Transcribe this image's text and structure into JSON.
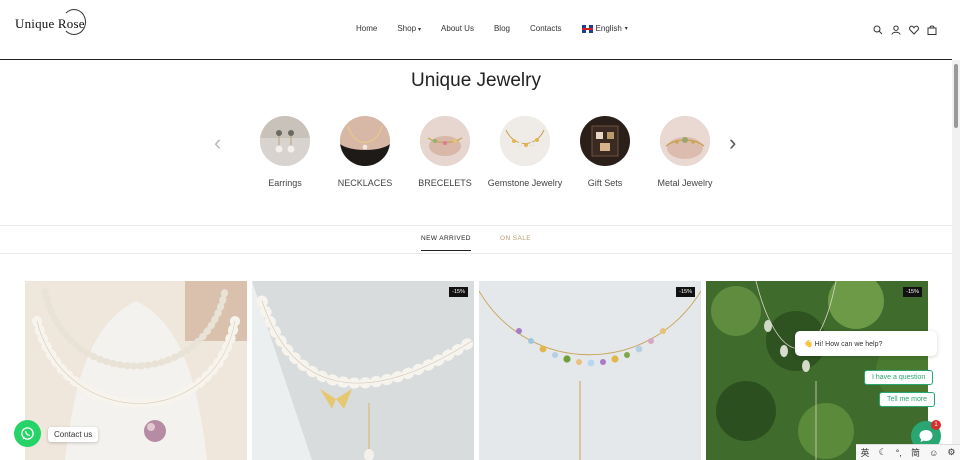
{
  "header": {
    "logo": "Unique Rose",
    "nav": [
      {
        "label": "Home"
      },
      {
        "label": "Shop",
        "caret": "▾"
      },
      {
        "label": "About Us"
      },
      {
        "label": "Blog"
      },
      {
        "label": "Contacts"
      }
    ],
    "language": "English",
    "language_caret": "▾",
    "icons": [
      "search-icon",
      "account-icon",
      "wishlist-icon",
      "cart-icon"
    ]
  },
  "categories": {
    "title": "Unique Jewelry",
    "prev_arrow": "‹",
    "next_arrow": "›",
    "items": [
      {
        "label": "Earrings"
      },
      {
        "label": "NECKLACES"
      },
      {
        "label": "BRECELETS"
      },
      {
        "label": "Gemstone Jewelry"
      },
      {
        "label": "Gift Sets"
      },
      {
        "label": "Metal Jewelry"
      }
    ]
  },
  "tabs": {
    "new_arrived": "NEW ARRIVED",
    "on_sale": "ON SALE"
  },
  "products": [
    {
      "badge": ""
    },
    {
      "badge": "-15%"
    },
    {
      "badge": "-15%"
    },
    {
      "badge": "-15%"
    }
  ],
  "chat": {
    "greeting": "👋 Hi! How can we help?",
    "question_button": "I have a question",
    "more_button": "Tell me more",
    "unread_count": "1"
  },
  "contact": {
    "label": "Contact us"
  },
  "ime": {
    "mode": "英",
    "moon": "☾",
    "punct": "°,",
    "charset": "简",
    "emoji": "☺",
    "settings": "⚙"
  },
  "colors": {
    "accent_green": "#2aa673",
    "whatsapp_green": "#25d366",
    "on_sale_gold": "#b89c73"
  }
}
